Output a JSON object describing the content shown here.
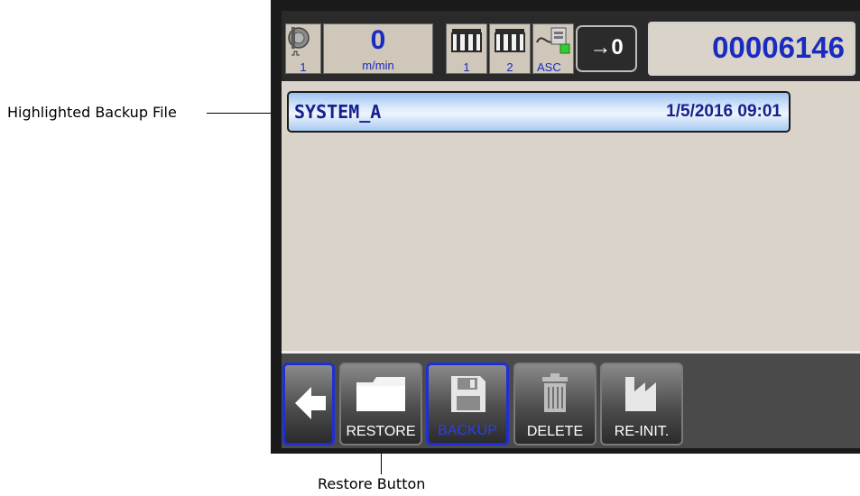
{
  "callouts": {
    "highlighted": "Highlighted Backup File",
    "restore": "Restore Button"
  },
  "status": {
    "encoder_num": "1",
    "speed_value": "0",
    "speed_unit": "m/min",
    "printhead1_num": "1",
    "printhead2_num": "2",
    "asc_label": "ASC",
    "reset_label": "→0",
    "counter": "00006146"
  },
  "backups": [
    {
      "name": "SYSTEM_A",
      "date": "1/5/2016 09:01",
      "highlighted": true
    }
  ],
  "toolbar": {
    "back_icon": "arrow-left-icon",
    "restore_label": "RESTORE",
    "backup_label": "BACKUP",
    "delete_label": "DELETE",
    "reinit_label": "RE-INIT."
  },
  "colors": {
    "accent_blue": "#1a2bbf",
    "active_border": "#1f2fd6",
    "screen_bg": "#d9d3c9",
    "toolbar_bg": "#4a4a4a"
  }
}
